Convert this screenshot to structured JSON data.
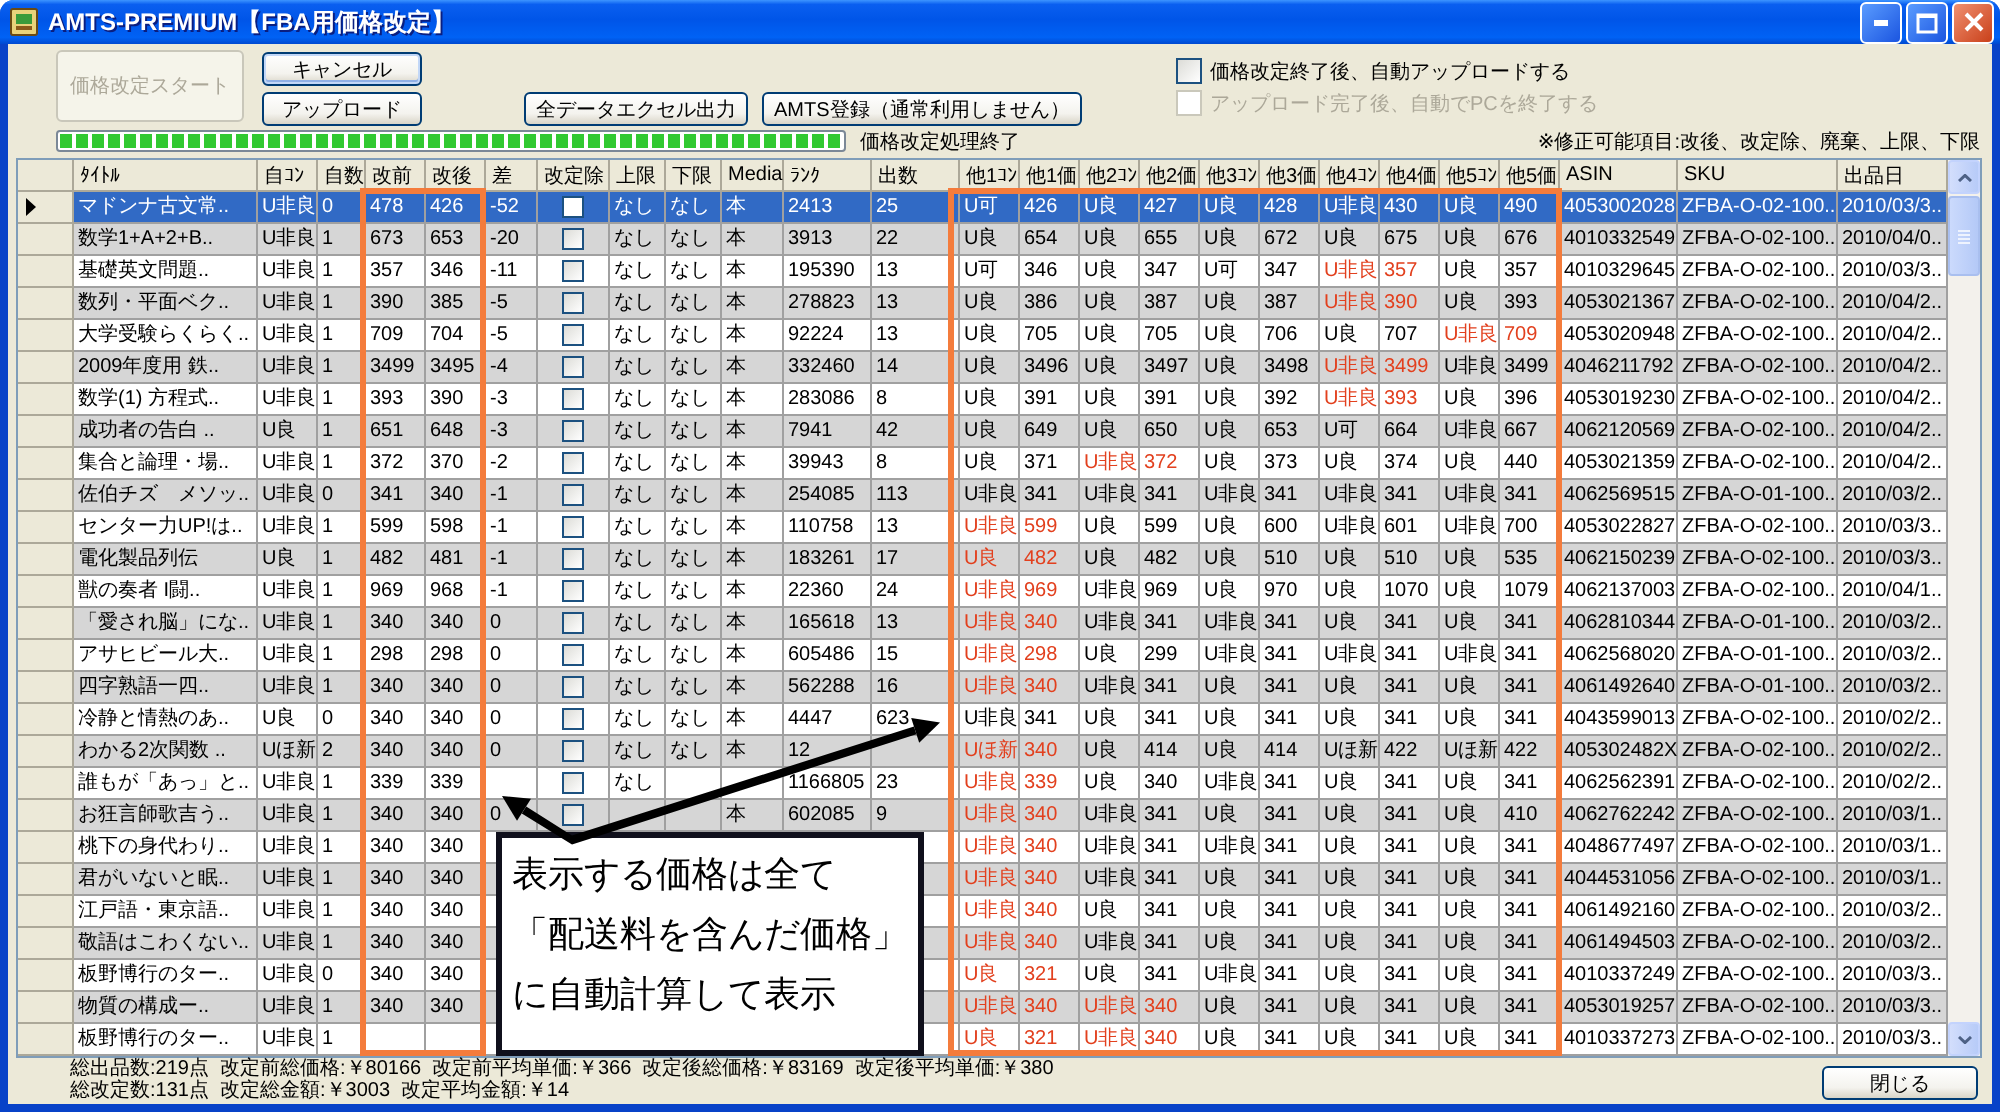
{
  "window": {
    "title": "AMTS-PREMIUM【FBA用価格改定】"
  },
  "actions": [
    {
      "label": "価格改定スタート",
      "disabled": true,
      "focused": false
    },
    {
      "label": "キャンセル",
      "disabled": false,
      "focused": true
    },
    {
      "label": "アップロード",
      "disabled": false,
      "focused": false
    },
    {
      "label": "全データエクセル出力",
      "disabled": false,
      "focused": false
    },
    {
      "label": "AMTS登録（通常利用しません）",
      "disabled": false,
      "focused": false
    }
  ],
  "options": [
    {
      "label": "価格改定終了後、自動アップロードする",
      "checked": false,
      "disabled": false
    },
    {
      "label": "アップロード完了後、自動でPCを終了する",
      "checked": false,
      "disabled": true
    }
  ],
  "progress": {
    "level": 1,
    "status": "価格改定処理終了"
  },
  "note": "※修正可能項目:改後、改定除、廃棄、上限、下限",
  "table": {
    "columns": [
      "ﾀｲﾄﾙ",
      "自ｺﾝ",
      "自数",
      "改前",
      "改後",
      "差",
      "改定除",
      "上限",
      "下限",
      "Media",
      "ﾗﾝｸ",
      "出数",
      "他1ｺﾝ",
      "他1価",
      "他2ｺﾝ",
      "他2価",
      "他3ｺﾝ",
      "他3価",
      "他4ｺﾝ",
      "他4価",
      "他5ｺﾝ",
      "他5価",
      "ASIN",
      "SKU",
      "出品日"
    ],
    "rows": [
      {
        "title": "マドンナ古文常..",
        "condition": "U非良",
        "count": "0",
        "price_before": "478",
        "price_after": "426",
        "difference": "-52",
        "excluded": false,
        "upper_limit": "なし",
        "lower_limit": "なし",
        "media": "本",
        "rank": "2413",
        "offers": "25",
        "competitors": [
          {
            "condition": "U可",
            "price": "426",
            "highlighted": false
          },
          {
            "condition": "U良",
            "price": "427",
            "highlighted": false
          },
          {
            "condition": "U良",
            "price": "428",
            "highlighted": false
          },
          {
            "condition": "U非良",
            "price": "430",
            "highlighted": false
          },
          {
            "condition": "U良",
            "price": "490",
            "highlighted": false
          }
        ],
        "asin": "4053002028",
        "sku": "ZFBA-O-02-100..",
        "listed": "2010/03/3..",
        "selected": true
      },
      {
        "title": "数学1+A+2+B..",
        "condition": "U非良",
        "count": "1",
        "price_before": "673",
        "price_after": "653",
        "difference": "-20",
        "excluded": false,
        "upper_limit": "なし",
        "lower_limit": "なし",
        "media": "本",
        "rank": "3913",
        "offers": "22",
        "competitors": [
          {
            "condition": "U良",
            "price": "654",
            "highlighted": false
          },
          {
            "condition": "U良",
            "price": "655",
            "highlighted": false
          },
          {
            "condition": "U良",
            "price": "672",
            "highlighted": false
          },
          {
            "condition": "U良",
            "price": "675",
            "highlighted": false
          },
          {
            "condition": "U良",
            "price": "676",
            "highlighted": false
          }
        ],
        "asin": "4010332549",
        "sku": "ZFBA-O-02-100..",
        "listed": "2010/04/0..",
        "selected": false
      },
      {
        "title": "基礎英文問題..",
        "condition": "U非良",
        "count": "1",
        "price_before": "357",
        "price_after": "346",
        "difference": "-11",
        "excluded": false,
        "upper_limit": "なし",
        "lower_limit": "なし",
        "media": "本",
        "rank": "195390",
        "offers": "13",
        "competitors": [
          {
            "condition": "U可",
            "price": "346",
            "highlighted": false
          },
          {
            "condition": "U良",
            "price": "347",
            "highlighted": false
          },
          {
            "condition": "U可",
            "price": "347",
            "highlighted": false
          },
          {
            "condition": "U非良",
            "price": "357",
            "highlighted": true
          },
          {
            "condition": "U良",
            "price": "357",
            "highlighted": false
          }
        ],
        "asin": "4010329645",
        "sku": "ZFBA-O-02-100..",
        "listed": "2010/03/3..",
        "selected": false
      },
      {
        "title": "数列・平面ベク..",
        "condition": "U非良",
        "count": "1",
        "price_before": "390",
        "price_after": "385",
        "difference": "-5",
        "excluded": false,
        "upper_limit": "なし",
        "lower_limit": "なし",
        "media": "本",
        "rank": "278823",
        "offers": "13",
        "competitors": [
          {
            "condition": "U良",
            "price": "386",
            "highlighted": false
          },
          {
            "condition": "U良",
            "price": "387",
            "highlighted": false
          },
          {
            "condition": "U良",
            "price": "387",
            "highlighted": false
          },
          {
            "condition": "U非良",
            "price": "390",
            "highlighted": true
          },
          {
            "condition": "U良",
            "price": "393",
            "highlighted": false
          }
        ],
        "asin": "4053021367",
        "sku": "ZFBA-O-02-100..",
        "listed": "2010/04/2..",
        "selected": false
      },
      {
        "title": "大学受験らくらく..",
        "condition": "U非良",
        "count": "1",
        "price_before": "709",
        "price_after": "704",
        "difference": "-5",
        "excluded": false,
        "upper_limit": "なし",
        "lower_limit": "なし",
        "media": "本",
        "rank": "92224",
        "offers": "13",
        "competitors": [
          {
            "condition": "U良",
            "price": "705",
            "highlighted": false
          },
          {
            "condition": "U良",
            "price": "705",
            "highlighted": false
          },
          {
            "condition": "U良",
            "price": "706",
            "highlighted": false
          },
          {
            "condition": "U良",
            "price": "707",
            "highlighted": false
          },
          {
            "condition": "U非良",
            "price": "709",
            "highlighted": true
          }
        ],
        "asin": "4053020948",
        "sku": "ZFBA-O-02-100..",
        "listed": "2010/04/2..",
        "selected": false
      },
      {
        "title": "2009年度用 鉄..",
        "condition": "U非良",
        "count": "1",
        "price_before": "3499",
        "price_after": "3495",
        "difference": "-4",
        "excluded": false,
        "upper_limit": "なし",
        "lower_limit": "なし",
        "media": "本",
        "rank": "332460",
        "offers": "14",
        "competitors": [
          {
            "condition": "U良",
            "price": "3496",
            "highlighted": false
          },
          {
            "condition": "U良",
            "price": "3497",
            "highlighted": false
          },
          {
            "condition": "U良",
            "price": "3498",
            "highlighted": false
          },
          {
            "condition": "U非良",
            "price": "3499",
            "highlighted": true
          },
          {
            "condition": "U非良",
            "price": "3499",
            "highlighted": false
          }
        ],
        "asin": "4046211792",
        "sku": "ZFBA-O-02-100..",
        "listed": "2010/04/2..",
        "selected": false
      },
      {
        "title": "数学(1) 方程式..",
        "condition": "U非良",
        "count": "1",
        "price_before": "393",
        "price_after": "390",
        "difference": "-3",
        "excluded": false,
        "upper_limit": "なし",
        "lower_limit": "なし",
        "media": "本",
        "rank": "283086",
        "offers": "8",
        "competitors": [
          {
            "condition": "U良",
            "price": "391",
            "highlighted": false
          },
          {
            "condition": "U良",
            "price": "391",
            "highlighted": false
          },
          {
            "condition": "U良",
            "price": "392",
            "highlighted": false
          },
          {
            "condition": "U非良",
            "price": "393",
            "highlighted": true
          },
          {
            "condition": "U良",
            "price": "396",
            "highlighted": false
          }
        ],
        "asin": "4053019230",
        "sku": "ZFBA-O-02-100..",
        "listed": "2010/04/2..",
        "selected": false
      },
      {
        "title": "成功者の告白 ..",
        "condition": "U良",
        "count": "1",
        "price_before": "651",
        "price_after": "648",
        "difference": "-3",
        "excluded": false,
        "upper_limit": "なし",
        "lower_limit": "なし",
        "media": "本",
        "rank": "7941",
        "offers": "42",
        "competitors": [
          {
            "condition": "U良",
            "price": "649",
            "highlighted": false
          },
          {
            "condition": "U良",
            "price": "650",
            "highlighted": false
          },
          {
            "condition": "U良",
            "price": "653",
            "highlighted": false
          },
          {
            "condition": "U可",
            "price": "664",
            "highlighted": false
          },
          {
            "condition": "U非良",
            "price": "667",
            "highlighted": false
          }
        ],
        "asin": "4062120569",
        "sku": "ZFBA-O-02-100..",
        "listed": "2010/04/2..",
        "selected": false
      },
      {
        "title": "集合と論理・場..",
        "condition": "U非良",
        "count": "1",
        "price_before": "372",
        "price_after": "370",
        "difference": "-2",
        "excluded": false,
        "upper_limit": "なし",
        "lower_limit": "なし",
        "media": "本",
        "rank": "39943",
        "offers": "8",
        "competitors": [
          {
            "condition": "U良",
            "price": "371",
            "highlighted": false
          },
          {
            "condition": "U非良",
            "price": "372",
            "highlighted": true
          },
          {
            "condition": "U良",
            "price": "373",
            "highlighted": false
          },
          {
            "condition": "U良",
            "price": "374",
            "highlighted": false
          },
          {
            "condition": "U良",
            "price": "440",
            "highlighted": false
          }
        ],
        "asin": "4053021359",
        "sku": "ZFBA-O-02-100..",
        "listed": "2010/04/2..",
        "selected": false
      },
      {
        "title": "佐伯チズ　メソッ..",
        "condition": "U非良",
        "count": "0",
        "price_before": "341",
        "price_after": "340",
        "difference": "-1",
        "excluded": false,
        "upper_limit": "なし",
        "lower_limit": "なし",
        "media": "本",
        "rank": "254085",
        "offers": "113",
        "competitors": [
          {
            "condition": "U非良",
            "price": "341",
            "highlighted": false
          },
          {
            "condition": "U非良",
            "price": "341",
            "highlighted": false
          },
          {
            "condition": "U非良",
            "price": "341",
            "highlighted": false
          },
          {
            "condition": "U非良",
            "price": "341",
            "highlighted": false
          },
          {
            "condition": "U非良",
            "price": "341",
            "highlighted": false
          }
        ],
        "asin": "4062569515",
        "sku": "ZFBA-O-01-100..",
        "listed": "2010/03/2..",
        "selected": false
      },
      {
        "title": "センター力UP!は..",
        "condition": "U非良",
        "count": "1",
        "price_before": "599",
        "price_after": "598",
        "difference": "-1",
        "excluded": false,
        "upper_limit": "なし",
        "lower_limit": "なし",
        "media": "本",
        "rank": "110758",
        "offers": "13",
        "competitors": [
          {
            "condition": "U非良",
            "price": "599",
            "highlighted": true
          },
          {
            "condition": "U良",
            "price": "599",
            "highlighted": false
          },
          {
            "condition": "U良",
            "price": "600",
            "highlighted": false
          },
          {
            "condition": "U非良",
            "price": "601",
            "highlighted": false
          },
          {
            "condition": "U非良",
            "price": "700",
            "highlighted": false
          }
        ],
        "asin": "4053022827",
        "sku": "ZFBA-O-02-100..",
        "listed": "2010/03/3..",
        "selected": false
      },
      {
        "title": "電化製品列伝",
        "condition": "U良",
        "count": "1",
        "price_before": "482",
        "price_after": "481",
        "difference": "-1",
        "excluded": false,
        "upper_limit": "なし",
        "lower_limit": "なし",
        "media": "本",
        "rank": "183261",
        "offers": "17",
        "competitors": [
          {
            "condition": "U良",
            "price": "482",
            "highlighted": true
          },
          {
            "condition": "U良",
            "price": "482",
            "highlighted": false
          },
          {
            "condition": "U良",
            "price": "510",
            "highlighted": false
          },
          {
            "condition": "U良",
            "price": "510",
            "highlighted": false
          },
          {
            "condition": "U良",
            "price": "535",
            "highlighted": false
          }
        ],
        "asin": "4062150239",
        "sku": "ZFBA-O-02-100..",
        "listed": "2010/03/3..",
        "selected": false
      },
      {
        "title": "獣の奏者 I闘..",
        "condition": "U非良",
        "count": "1",
        "price_before": "969",
        "price_after": "968",
        "difference": "-1",
        "excluded": false,
        "upper_limit": "なし",
        "lower_limit": "なし",
        "media": "本",
        "rank": "22360",
        "offers": "24",
        "competitors": [
          {
            "condition": "U非良",
            "price": "969",
            "highlighted": true
          },
          {
            "condition": "U非良",
            "price": "969",
            "highlighted": false
          },
          {
            "condition": "U良",
            "price": "970",
            "highlighted": false
          },
          {
            "condition": "U良",
            "price": "1070",
            "highlighted": false
          },
          {
            "condition": "U良",
            "price": "1079",
            "highlighted": false
          }
        ],
        "asin": "4062137003",
        "sku": "ZFBA-O-02-100..",
        "listed": "2010/04/1..",
        "selected": false
      },
      {
        "title": "「愛され脳」にな..",
        "condition": "U非良",
        "count": "1",
        "price_before": "340",
        "price_after": "340",
        "difference": "0",
        "excluded": false,
        "upper_limit": "なし",
        "lower_limit": "なし",
        "media": "本",
        "rank": "165618",
        "offers": "13",
        "competitors": [
          {
            "condition": "U非良",
            "price": "340",
            "highlighted": true
          },
          {
            "condition": "U非良",
            "price": "341",
            "highlighted": false
          },
          {
            "condition": "U非良",
            "price": "341",
            "highlighted": false
          },
          {
            "condition": "U良",
            "price": "341",
            "highlighted": false
          },
          {
            "condition": "U良",
            "price": "341",
            "highlighted": false
          }
        ],
        "asin": "4062810344",
        "sku": "ZFBA-O-01-100..",
        "listed": "2010/03/2..",
        "selected": false
      },
      {
        "title": "アサヒビール大..",
        "condition": "U非良",
        "count": "1",
        "price_before": "298",
        "price_after": "298",
        "difference": "0",
        "excluded": false,
        "upper_limit": "なし",
        "lower_limit": "なし",
        "media": "本",
        "rank": "605486",
        "offers": "15",
        "competitors": [
          {
            "condition": "U非良",
            "price": "298",
            "highlighted": true
          },
          {
            "condition": "U良",
            "price": "299",
            "highlighted": false
          },
          {
            "condition": "U非良",
            "price": "341",
            "highlighted": false
          },
          {
            "condition": "U非良",
            "price": "341",
            "highlighted": false
          },
          {
            "condition": "U非良",
            "price": "341",
            "highlighted": false
          }
        ],
        "asin": "4062568020",
        "sku": "ZFBA-O-01-100..",
        "listed": "2010/03/2..",
        "selected": false
      },
      {
        "title": "四字熟語一四..",
        "condition": "U非良",
        "count": "1",
        "price_before": "340",
        "price_after": "340",
        "difference": "0",
        "excluded": false,
        "upper_limit": "なし",
        "lower_limit": "なし",
        "media": "本",
        "rank": "562288",
        "offers": "16",
        "competitors": [
          {
            "condition": "U非良",
            "price": "340",
            "highlighted": true
          },
          {
            "condition": "U非良",
            "price": "341",
            "highlighted": false
          },
          {
            "condition": "U良",
            "price": "341",
            "highlighted": false
          },
          {
            "condition": "U良",
            "price": "341",
            "highlighted": false
          },
          {
            "condition": "U良",
            "price": "341",
            "highlighted": false
          }
        ],
        "asin": "4061492640",
        "sku": "ZFBA-O-01-100..",
        "listed": "2010/03/2..",
        "selected": false
      },
      {
        "title": "冷静と情熱のあ..",
        "condition": "U良",
        "count": "0",
        "price_before": "340",
        "price_after": "340",
        "difference": "0",
        "excluded": false,
        "upper_limit": "なし",
        "lower_limit": "なし",
        "media": "本",
        "rank": "4447",
        "offers": "623",
        "competitors": [
          {
            "condition": "U非良",
            "price": "341",
            "highlighted": false
          },
          {
            "condition": "U良",
            "price": "341",
            "highlighted": false
          },
          {
            "condition": "U良",
            "price": "341",
            "highlighted": false
          },
          {
            "condition": "U良",
            "price": "341",
            "highlighted": false
          },
          {
            "condition": "U良",
            "price": "341",
            "highlighted": false
          }
        ],
        "asin": "4043599013",
        "sku": "ZFBA-O-02-100..",
        "listed": "2010/02/2..",
        "selected": false
      },
      {
        "title": "わかる2次関数 ..",
        "condition": "Uほ新",
        "count": "2",
        "price_before": "340",
        "price_after": "340",
        "difference": "0",
        "excluded": false,
        "upper_limit": "なし",
        "lower_limit": "なし",
        "media": "本",
        "rank": "12",
        "competitors": [
          {
            "condition": "Uほ新",
            "price": "340",
            "highlighted": true
          },
          {
            "condition": "U良",
            "price": "414",
            "highlighted": false
          },
          {
            "condition": "U良",
            "price": "414",
            "highlighted": false
          },
          {
            "condition": "Uほ新",
            "price": "422",
            "highlighted": false
          },
          {
            "condition": "Uほ新",
            "price": "422",
            "highlighted": false
          }
        ],
        "asin": "405302482X",
        "sku": "ZFBA-O-02-100..",
        "listed": "2010/02/2..",
        "selected": false
      },
      {
        "title": "誰もが「あっ」と..",
        "condition": "U非良",
        "count": "1",
        "price_before": "339",
        "price_after": "339",
        "excluded": false,
        "upper_limit": "なし",
        "rank": "1166805",
        "offers": "23",
        "competitors": [
          {
            "condition": "U非良",
            "price": "339",
            "highlighted": true
          },
          {
            "condition": "U良",
            "price": "340",
            "highlighted": false
          },
          {
            "condition": "U非良",
            "price": "341",
            "highlighted": false
          },
          {
            "condition": "U良",
            "price": "341",
            "highlighted": false
          },
          {
            "condition": "U良",
            "price": "341",
            "highlighted": false
          }
        ],
        "asin": "4062562391",
        "sku": "ZFBA-O-02-100..",
        "listed": "2010/02/2..",
        "selected": false
      },
      {
        "title": "お狂言師歌吉う..",
        "condition": "U非良",
        "count": "1",
        "price_before": "340",
        "price_after": "340",
        "difference": "0",
        "excluded": false,
        "media": "本",
        "rank": "602085",
        "offers": "9",
        "competitors": [
          {
            "condition": "U非良",
            "price": "340",
            "highlighted": true
          },
          {
            "condition": "U非良",
            "price": "341",
            "highlighted": false
          },
          {
            "condition": "U良",
            "price": "341",
            "highlighted": false
          },
          {
            "condition": "U良",
            "price": "341",
            "highlighted": false
          },
          {
            "condition": "U良",
            "price": "410",
            "highlighted": false
          }
        ],
        "asin": "4062762242",
        "sku": "ZFBA-O-02-100..",
        "listed": "2010/03/1..",
        "selected": false
      },
      {
        "title": "桃下の身代わり..",
        "condition": "U非良",
        "count": "1",
        "price_before": "340",
        "price_after": "340",
        "competitors": [
          {
            "condition": "U非良",
            "price": "340",
            "highlighted": true
          },
          {
            "condition": "U非良",
            "price": "341",
            "highlighted": false
          },
          {
            "condition": "U非良",
            "price": "341",
            "highlighted": false
          },
          {
            "condition": "U良",
            "price": "341",
            "highlighted": false
          },
          {
            "condition": "U良",
            "price": "341",
            "highlighted": false
          }
        ],
        "asin": "4048677497",
        "sku": "ZFBA-O-02-100..",
        "listed": "2010/03/1..",
        "selected": false
      },
      {
        "title": "君がいないと眠..",
        "condition": "U非良",
        "count": "1",
        "price_before": "340",
        "price_after": "340",
        "competitors": [
          {
            "condition": "U非良",
            "price": "340",
            "highlighted": true
          },
          {
            "condition": "U非良",
            "price": "341",
            "highlighted": false
          },
          {
            "condition": "U良",
            "price": "341",
            "highlighted": false
          },
          {
            "condition": "U良",
            "price": "341",
            "highlighted": false
          },
          {
            "condition": "U良",
            "price": "341",
            "highlighted": false
          }
        ],
        "asin": "4044531056",
        "sku": "ZFBA-O-02-100..",
        "listed": "2010/03/1..",
        "selected": false
      },
      {
        "title": "江戸語・東京語..",
        "condition": "U非良",
        "count": "1",
        "price_before": "340",
        "price_after": "340",
        "competitors": [
          {
            "condition": "U非良",
            "price": "340",
            "highlighted": true
          },
          {
            "condition": "U良",
            "price": "341",
            "highlighted": false
          },
          {
            "condition": "U良",
            "price": "341",
            "highlighted": false
          },
          {
            "condition": "U良",
            "price": "341",
            "highlighted": false
          },
          {
            "condition": "U良",
            "price": "341",
            "highlighted": false
          }
        ],
        "asin": "4061492160",
        "sku": "ZFBA-O-02-100..",
        "listed": "2010/03/2..",
        "selected": false
      },
      {
        "title": "敬語はこわくない..",
        "condition": "U非良",
        "count": "1",
        "price_before": "340",
        "price_after": "340",
        "competitors": [
          {
            "condition": "U非良",
            "price": "340",
            "highlighted": true
          },
          {
            "condition": "U非良",
            "price": "341",
            "highlighted": false
          },
          {
            "condition": "U良",
            "price": "341",
            "highlighted": false
          },
          {
            "condition": "U良",
            "price": "341",
            "highlighted": false
          },
          {
            "condition": "U良",
            "price": "341",
            "highlighted": false
          }
        ],
        "asin": "4061494503",
        "sku": "ZFBA-O-02-100..",
        "listed": "2010/03/2..",
        "selected": false
      },
      {
        "title": "板野博行のター..",
        "condition": "U非良",
        "count": "0",
        "price_before": "340",
        "price_after": "340",
        "competitors": [
          {
            "condition": "U良",
            "price": "321",
            "highlighted": true
          },
          {
            "condition": "U良",
            "price": "341",
            "highlighted": false
          },
          {
            "condition": "U非良",
            "price": "341",
            "highlighted": false
          },
          {
            "condition": "U良",
            "price": "341",
            "highlighted": false
          },
          {
            "condition": "U良",
            "price": "341",
            "highlighted": false
          }
        ],
        "asin": "4010337249",
        "sku": "ZFBA-O-02-100..",
        "listed": "2010/03/3..",
        "selected": false
      },
      {
        "title": "物質の構成ー..",
        "condition": "U非良",
        "count": "1",
        "price_before": "340",
        "price_after": "340",
        "competitors": [
          {
            "condition": "U非良",
            "price": "340",
            "highlighted": true
          },
          {
            "condition": "U非良",
            "price": "340",
            "highlighted": true
          },
          {
            "condition": "U良",
            "price": "341",
            "highlighted": false
          },
          {
            "condition": "U良",
            "price": "341",
            "highlighted": false
          },
          {
            "condition": "U良",
            "price": "341",
            "highlighted": false
          }
        ],
        "asin": "4053019257",
        "sku": "ZFBA-O-02-100..",
        "listed": "2010/03/3..",
        "selected": false
      },
      {
        "title": "板野博行のター..",
        "condition": "U非良",
        "count": "1",
        "competitors": [
          {
            "condition": "U良",
            "price": "321",
            "highlighted": true
          },
          {
            "condition": "U非良",
            "price": "340",
            "highlighted": true
          },
          {
            "condition": "U良",
            "price": "341",
            "highlighted": false
          },
          {
            "condition": "U良",
            "price": "341",
            "highlighted": false
          },
          {
            "condition": "U良",
            "price": "341",
            "highlighted": false
          }
        ],
        "asin": "4010337273",
        "sku": "ZFBA-O-02-100..",
        "listed": "2010/03/3..",
        "selected": false
      }
    ]
  },
  "callout": {
    "lines": [
      "表示する価格は全て",
      "「配送料を含んだ価格」",
      "に自動計算して表示"
    ]
  },
  "summary": [
    "総出品数:219点  改定前総価格:￥80166  改定前平均単価:￥366  改定後総価格:￥83169  改定後平均単価:￥380",
    "総改定数:131点  改定総金額:￥3003  改定平均金額:￥14"
  ],
  "close_button": "閉じる"
}
